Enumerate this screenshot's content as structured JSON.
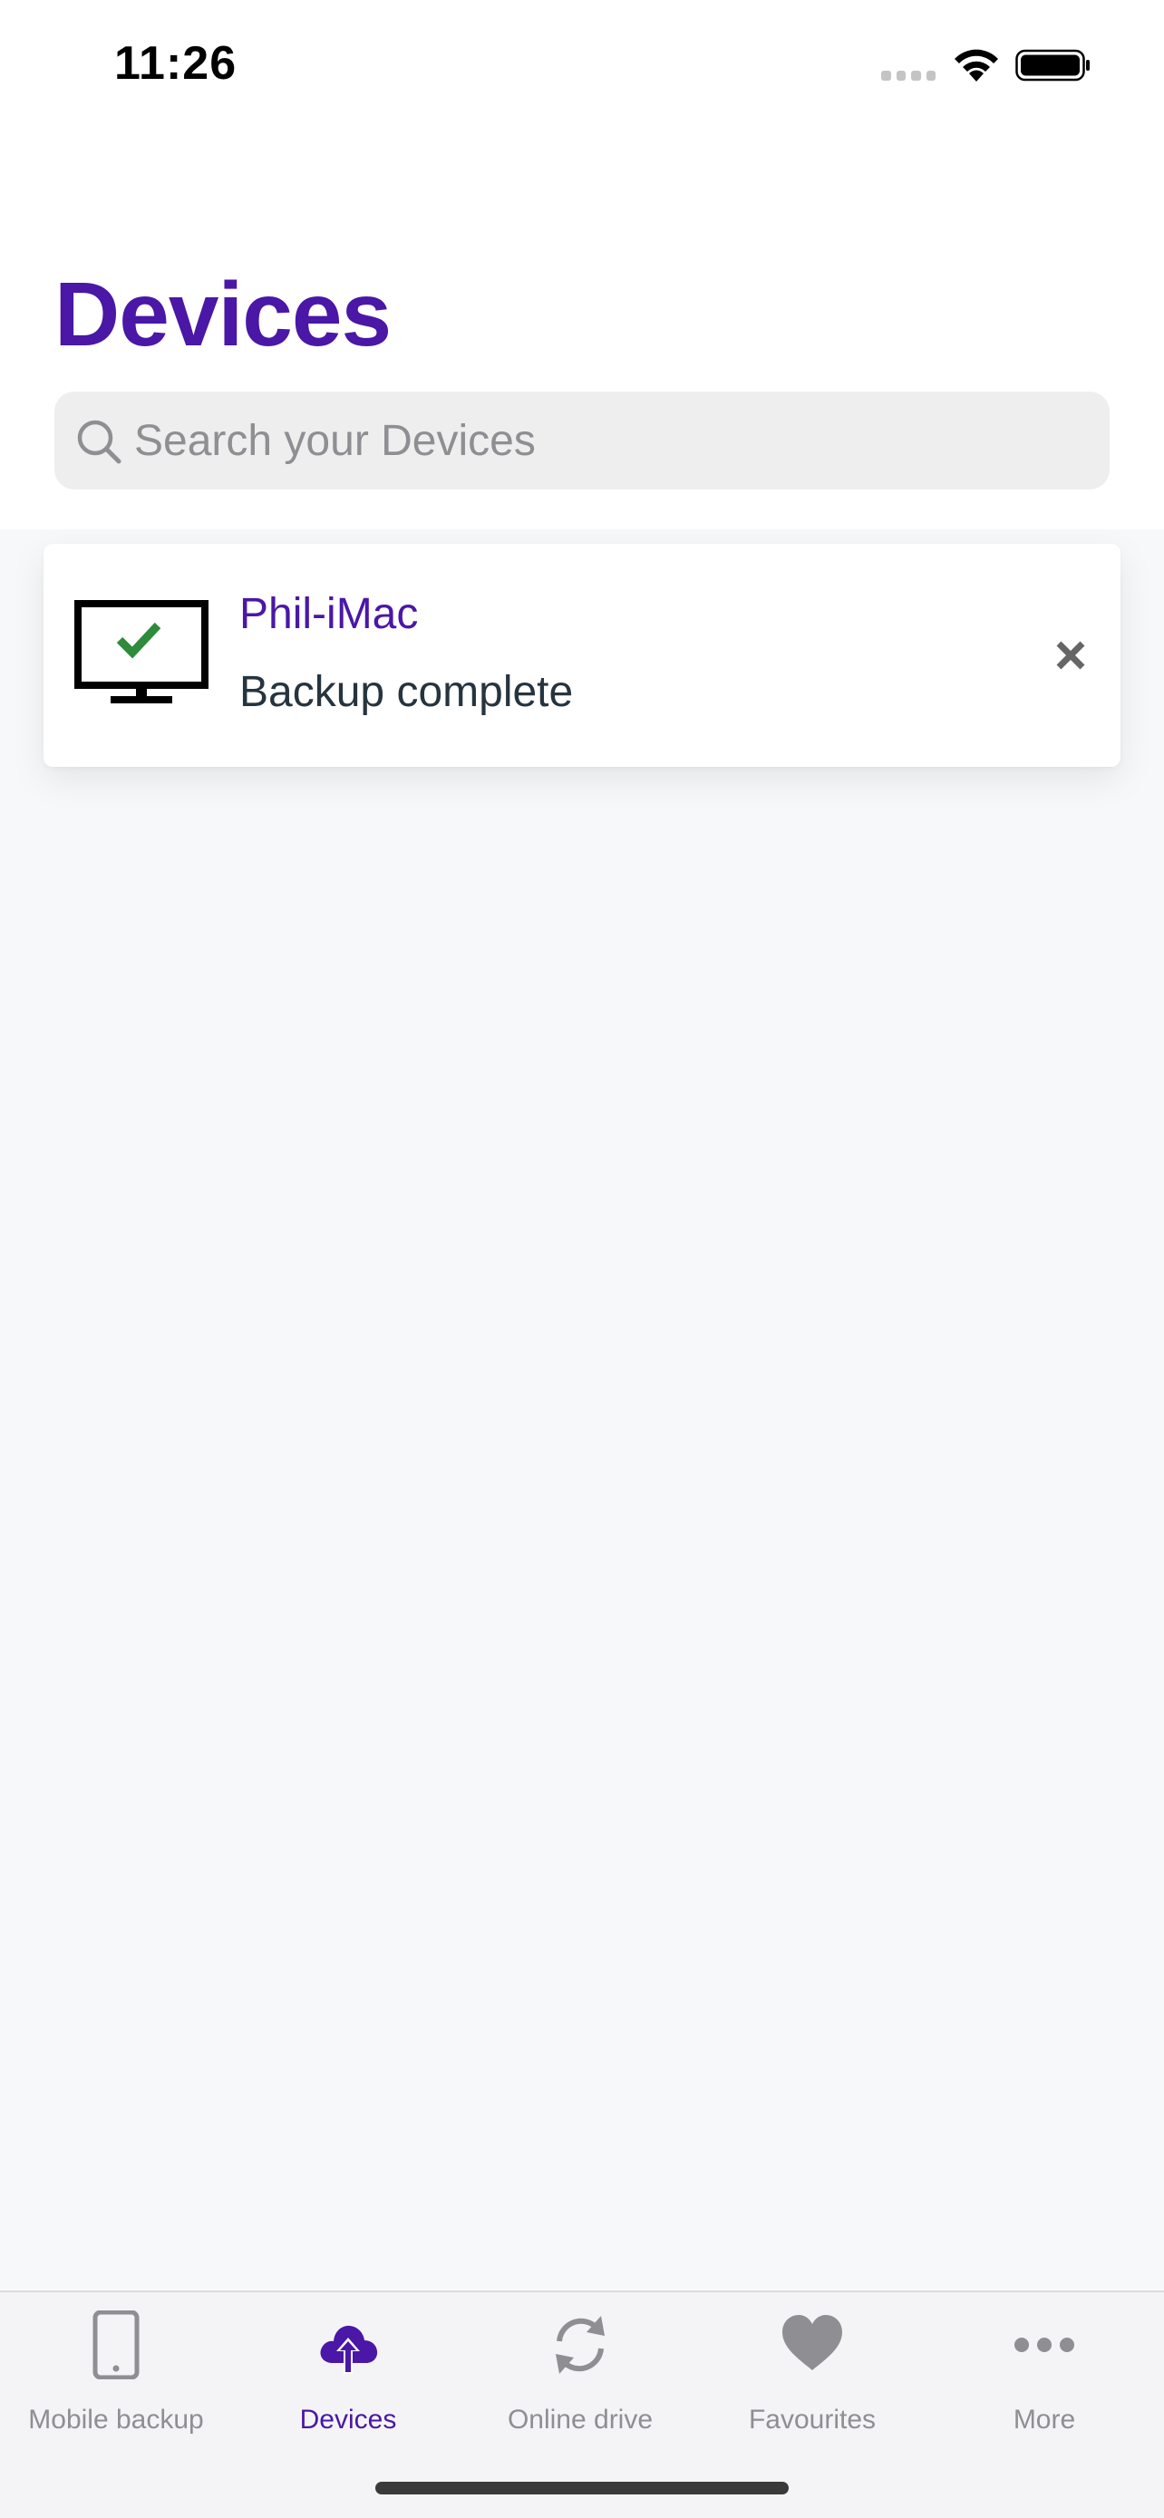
{
  "status_bar": {
    "time": "11:26"
  },
  "header": {
    "title": "Devices"
  },
  "search": {
    "placeholder": "Search your Devices",
    "value": ""
  },
  "devices": [
    {
      "name": "Phil-iMac",
      "status": "Backup complete",
      "icon": "monitor-check-icon"
    }
  ],
  "tab_bar": {
    "active": "Devices",
    "tabs": [
      {
        "label": "Mobile backup",
        "icon": "phone-icon"
      },
      {
        "label": "Devices",
        "icon": "cloud-upload-icon"
      },
      {
        "label": "Online drive",
        "icon": "sync-icon"
      },
      {
        "label": "Favourites",
        "icon": "heart-icon"
      },
      {
        "label": "More",
        "icon": "more-dots-icon"
      }
    ]
  },
  "colors": {
    "accent": "#4a17a6",
    "success": "#2e8b3a",
    "inactive": "#8e8e93",
    "text_dark": "#26343f",
    "background": "#f7f8fa"
  }
}
